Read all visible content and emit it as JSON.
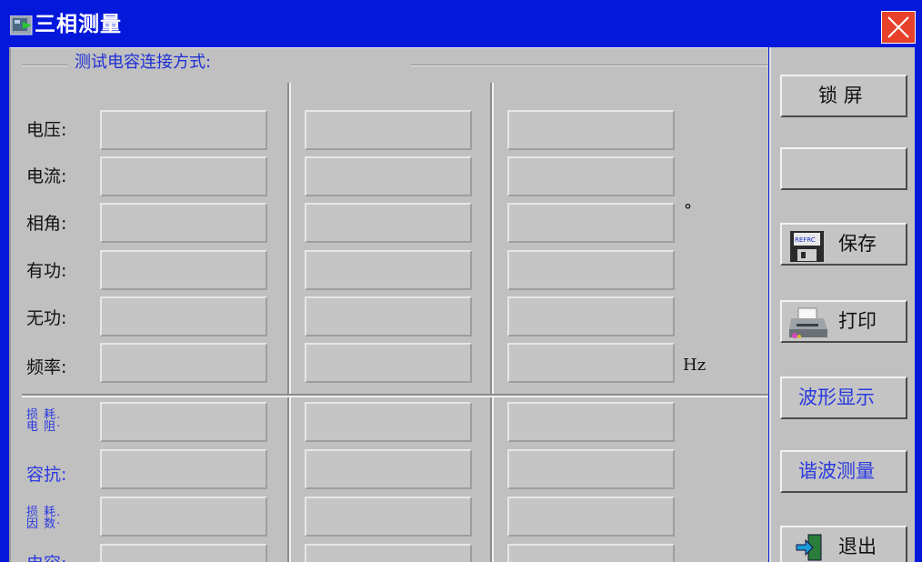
{
  "window": {
    "title": "三相测量"
  },
  "group": {
    "title": "测试电容连接方式:"
  },
  "rows": [
    {
      "label": "电压:",
      "unit": ""
    },
    {
      "label": "电流:",
      "unit": ""
    },
    {
      "label": "相角:",
      "unit": "°"
    },
    {
      "label": "有功:",
      "unit": ""
    },
    {
      "label": "无功:",
      "unit": ""
    },
    {
      "label": "频率:",
      "unit": "Hz"
    }
  ],
  "lower_rows": [
    {
      "label_line1": "损 耗.",
      "label_line2": "电 阻·"
    },
    {
      "label": "容抗:"
    },
    {
      "label_line1": "损 耗.",
      "label_line2": "因 数·"
    },
    {
      "label": "电容:"
    }
  ],
  "buttons": {
    "lock_screen": "锁 屏",
    "blank": "",
    "save": "保存",
    "save_icon_text": "REFRC",
    "print": "打印",
    "waveform": "波形显示",
    "harmonic": "谐波测量",
    "exit": "退出"
  },
  "colors": {
    "titlebar": "#0418dc",
    "panel": "#c0c0c0",
    "accent_text": "#2b3ae0",
    "close": "#e8412a"
  },
  "icons": [
    "app-icon",
    "close-icon",
    "floppy-disk-icon",
    "printer-icon",
    "exit-door-icon"
  ]
}
